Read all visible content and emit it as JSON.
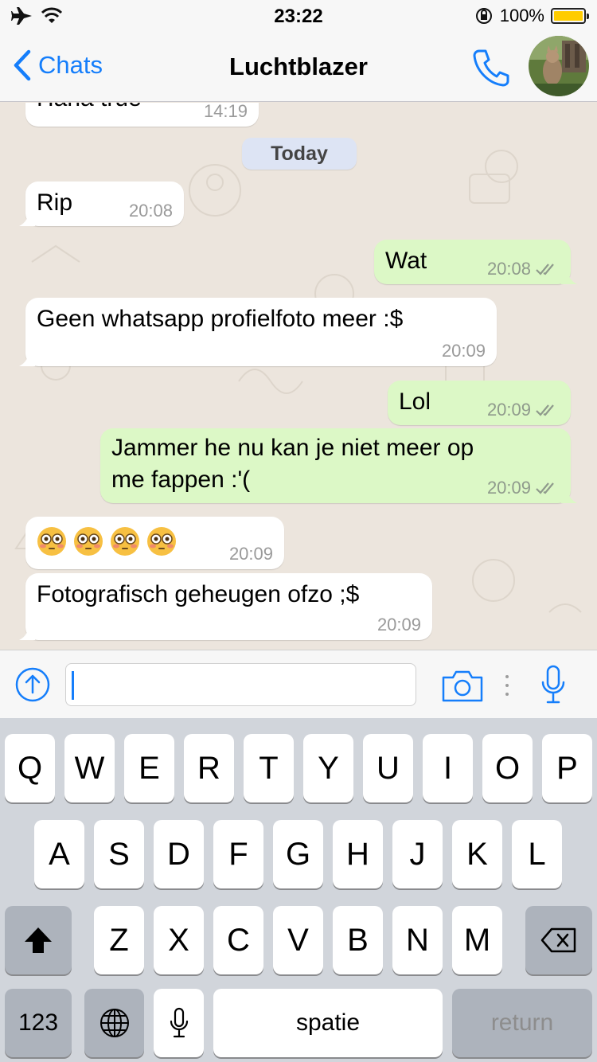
{
  "status_bar": {
    "time": "23:22",
    "battery": "100%",
    "battery_level": 1.0,
    "battery_color": "#ffcc00"
  },
  "nav": {
    "back_label": "Chats",
    "title": "Luchtblazer",
    "accent_color": "#157efb"
  },
  "chat": {
    "date_divider": "Today",
    "messages": [
      {
        "direction": "in",
        "text": "Haha true",
        "time": "14:19"
      },
      {
        "direction": "in",
        "text": "Rip",
        "time": "20:08"
      },
      {
        "direction": "out",
        "text": "Wat",
        "time": "20:08",
        "status": "read"
      },
      {
        "direction": "in",
        "text": "Geen whatsapp profielfoto meer :$",
        "time": "20:09"
      },
      {
        "direction": "out",
        "text": "Lol",
        "time": "20:09",
        "status": "read"
      },
      {
        "direction": "out",
        "text_lines": [
          "Jammer he nu kan je niet meer op",
          "me fappen :'("
        ],
        "time": "20:09",
        "status": "read"
      },
      {
        "direction": "in",
        "emoji": [
          "flushed-face",
          "flushed-face",
          "flushed-face",
          "flushed-face"
        ],
        "time": "20:09"
      },
      {
        "direction": "in",
        "text": "Fotografisch geheugen ofzo ;$",
        "time": "20:09"
      }
    ],
    "incoming_bubble_color": "#ffffff",
    "outgoing_bubble_color": "#dcf8c6",
    "background_color": "#ece5dd"
  },
  "input_bar": {
    "value": "",
    "placeholder": ""
  },
  "keyboard": {
    "row1": [
      "Q",
      "W",
      "E",
      "R",
      "T",
      "Y",
      "U",
      "I",
      "O",
      "P"
    ],
    "row2": [
      "A",
      "S",
      "D",
      "F",
      "G",
      "H",
      "J",
      "K",
      "L"
    ],
    "row3": [
      "Z",
      "X",
      "C",
      "V",
      "B",
      "N",
      "M"
    ],
    "numbers_label": "123",
    "space_label": "spatie",
    "return_label": "return"
  }
}
